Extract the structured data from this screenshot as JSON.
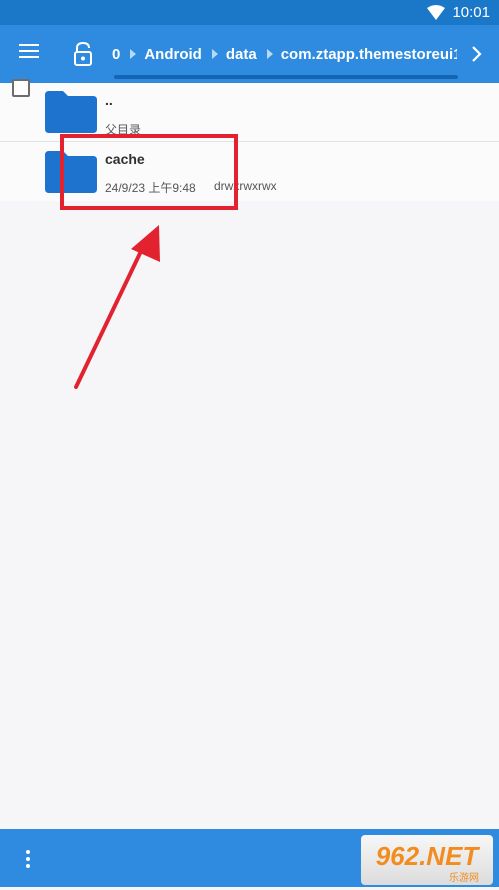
{
  "status_bar": {
    "time": "10:01"
  },
  "toolbar": {
    "breadcrumbs": [
      "0",
      "Android",
      "data",
      "com.ztapp.themestoreui1"
    ]
  },
  "list": {
    "parent": {
      "name": "..",
      "label": "父目录"
    },
    "items": [
      {
        "name": "cache",
        "date": "24/9/23 上午9:48",
        "perms": "drwxrwxrwx"
      }
    ]
  },
  "colors": {
    "toolbar": "#2e8be0",
    "folder": "#1e73cf",
    "highlight": "#e32230"
  },
  "watermark": {
    "text": "962.NET",
    "sub": "乐游网"
  }
}
